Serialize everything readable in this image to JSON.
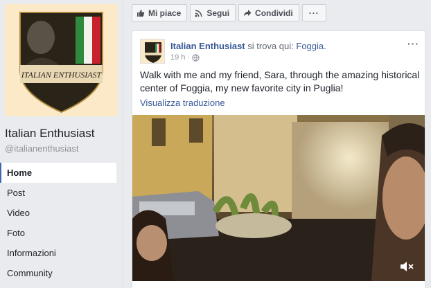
{
  "page": {
    "name": "Italian Enthusiast",
    "handle": "@italianenthusiast",
    "logo_text": "ITALIAN ENTHUSIAST",
    "nav": [
      {
        "label": "Home",
        "active": true
      },
      {
        "label": "Post"
      },
      {
        "label": "Video"
      },
      {
        "label": "Foto"
      },
      {
        "label": "Informazioni"
      },
      {
        "label": "Community"
      }
    ]
  },
  "actions": {
    "like": "Mi piace",
    "follow": "Segui",
    "share": "Condividi",
    "more": "···"
  },
  "post": {
    "author": "Italian Enthusiast",
    "checkin_text": "si trova qui:",
    "location": "Foggia.",
    "time": "19 h",
    "options": "···",
    "text": "Walk with me and my friend, Sara, through the amazing historical center of Foggia, my new favorite city in Puglia!",
    "translate": "Visualizza traduzione"
  },
  "colors": {
    "facebook_blue": "#4267b2",
    "link": "#365899",
    "background": "#e9ebee",
    "logo_bg": "#fbe9c8",
    "italy_green": "#2e8b3d",
    "italy_red": "#c8232c"
  },
  "icons": {
    "like": "thumbs-up-icon",
    "follow": "rss-icon",
    "share": "share-arrow-icon",
    "privacy": "globe-icon",
    "video": "mute-icon"
  }
}
